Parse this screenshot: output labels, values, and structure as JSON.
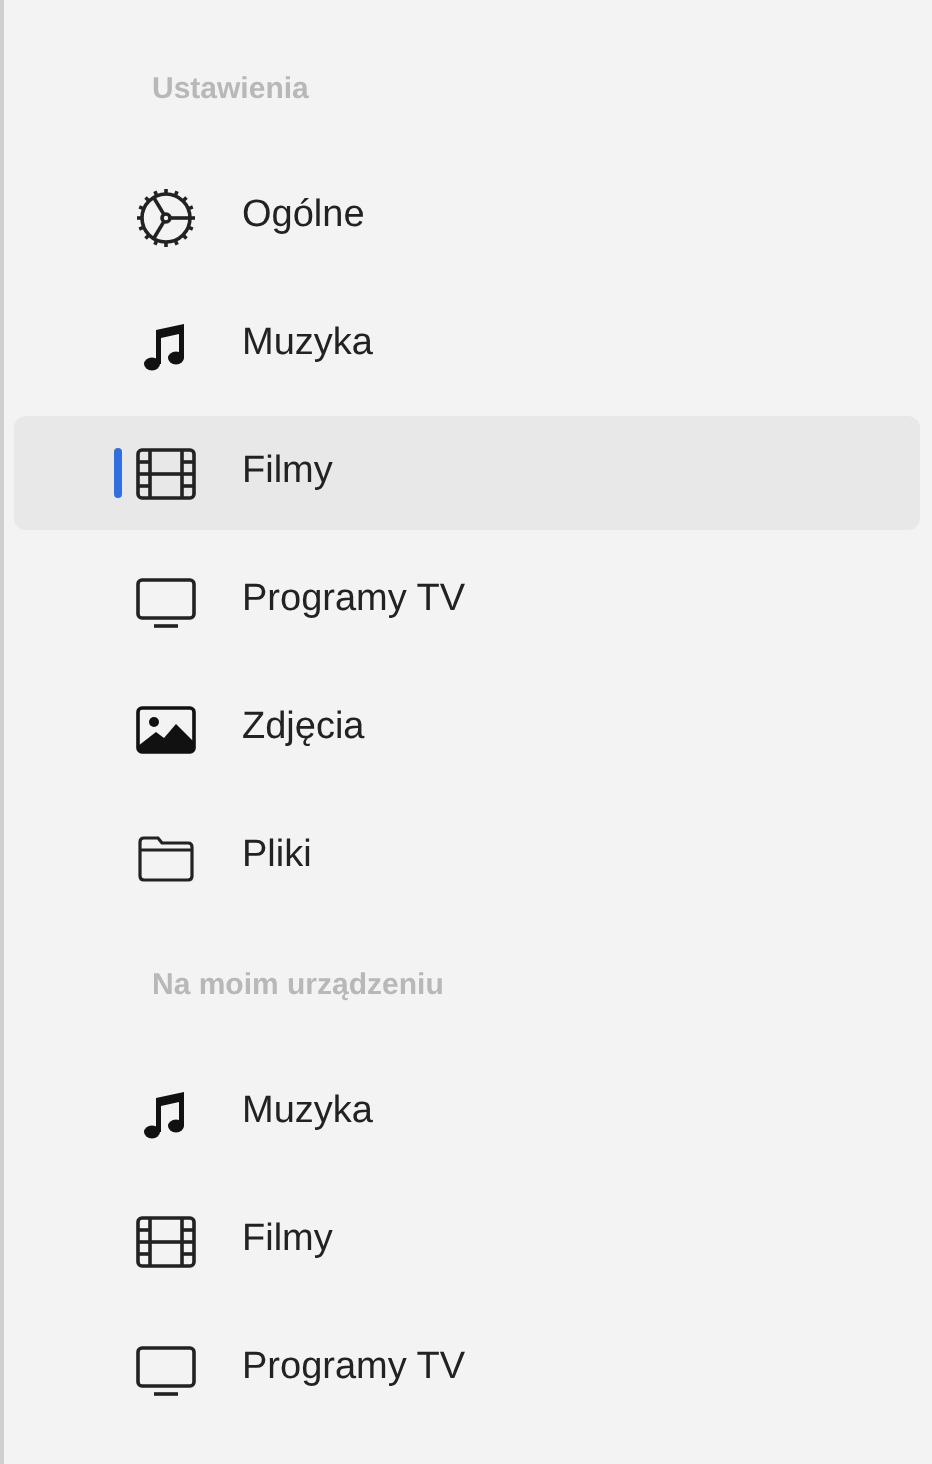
{
  "sections": [
    {
      "title": "Ustawienia",
      "items": [
        {
          "label": "Ogólne",
          "kind": "gear",
          "selected": false
        },
        {
          "label": "Muzyka",
          "kind": "music",
          "selected": false
        },
        {
          "label": "Filmy",
          "kind": "film",
          "selected": true
        },
        {
          "label": "Programy TV",
          "kind": "tv",
          "selected": false
        },
        {
          "label": "Zdjęcia",
          "kind": "photo",
          "selected": false
        },
        {
          "label": "Pliki",
          "kind": "folder",
          "selected": false
        }
      ]
    },
    {
      "title": "Na moim urządzeniu",
      "items": [
        {
          "label": "Muzyka",
          "kind": "music",
          "selected": false
        },
        {
          "label": "Filmy",
          "kind": "film",
          "selected": false
        },
        {
          "label": "Programy TV",
          "kind": "tv",
          "selected": false
        }
      ]
    }
  ]
}
